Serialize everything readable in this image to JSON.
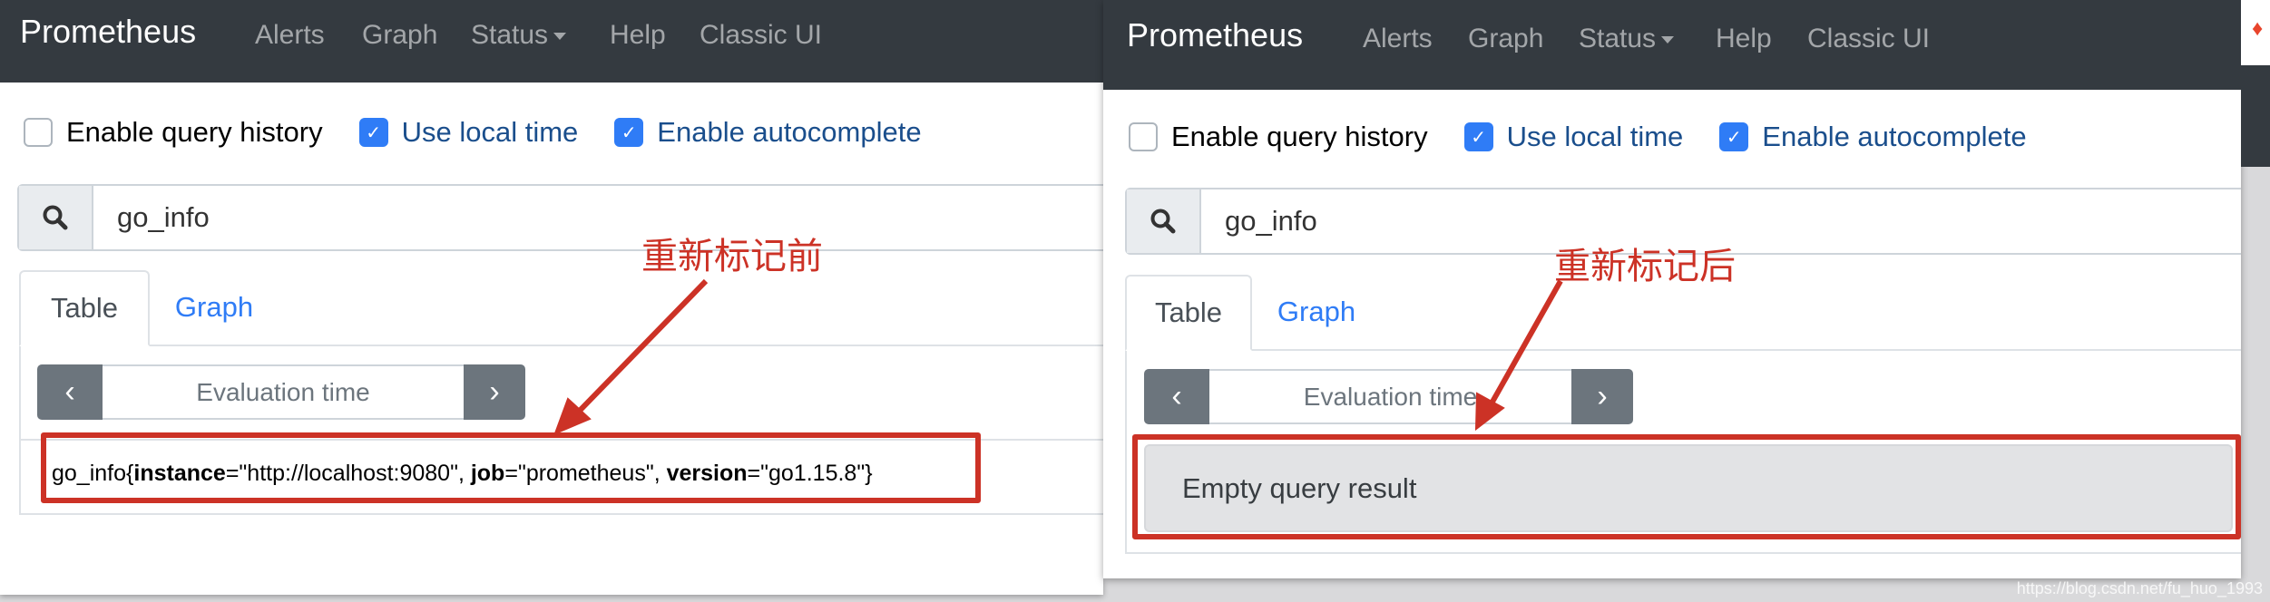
{
  "colors": {
    "navbar": "#343a40",
    "checkbox_on": "#2f7cf6",
    "annotation": "#cc3226",
    "link": "#2f7cf6"
  },
  "before": {
    "brand": "Prometheus",
    "nav": [
      "Alerts",
      "Graph",
      "Status",
      "Help",
      "Classic UI"
    ],
    "checkboxes": [
      {
        "label": "Enable query history",
        "checked": false
      },
      {
        "label": "Use local time",
        "checked": true
      },
      {
        "label": "Enable autocomplete",
        "checked": true
      }
    ],
    "query": "go_info",
    "tabs": [
      "Table",
      "Graph"
    ],
    "eval_placeholder": "Evaluation time",
    "result": {
      "metric": "go_info",
      "open": "{",
      "l1": "instance",
      "v1": "=\"http://localhost:9080\", ",
      "l2": "job",
      "v2": "=\"prometheus\", ",
      "l3": "version",
      "v3": "=\"go1.15.8\"",
      "close": "}"
    },
    "annotation": "重新标记前"
  },
  "after": {
    "brand": "Prometheus",
    "nav": [
      "Alerts",
      "Graph",
      "Status",
      "Help",
      "Classic UI"
    ],
    "checkboxes": [
      {
        "label": "Enable query history",
        "checked": false
      },
      {
        "label": "Use local time",
        "checked": true
      },
      {
        "label": "Enable autocomplete",
        "checked": true
      }
    ],
    "query": "go_info",
    "tabs": [
      "Table",
      "Graph"
    ],
    "eval_placeholder": "Evaluation time",
    "result_message": "Empty query result",
    "annotation": "重新标记后"
  },
  "watermark": "https://blog.csdn.net/fu_huo_1993"
}
